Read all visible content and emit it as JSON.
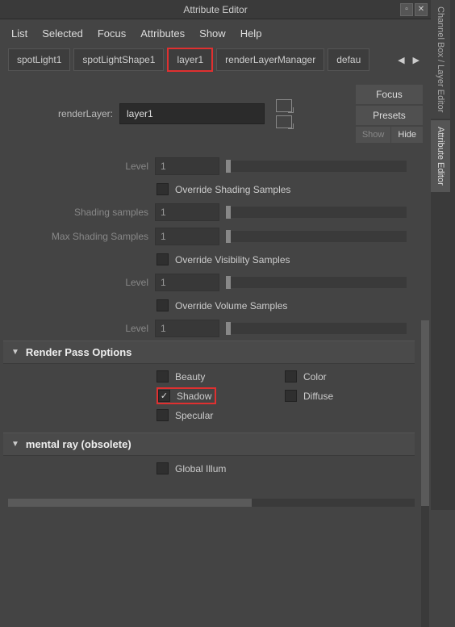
{
  "title": "Attribute Editor",
  "menu": {
    "list": "List",
    "selected": "Selected",
    "focus": "Focus",
    "attributes": "Attributes",
    "show": "Show",
    "help": "Help"
  },
  "tabs": [
    "spotLight1",
    "spotLightShape1",
    "layer1",
    "renderLayerManager",
    "defau"
  ],
  "layer": {
    "label": "renderLayer:",
    "value": "layer1"
  },
  "right_buttons": {
    "focus": "Focus",
    "presets": "Presets",
    "show": "Show",
    "hide": "Hide"
  },
  "attrs": {
    "level1": {
      "label": "Level",
      "value": "1"
    },
    "override_shading": "Override Shading Samples",
    "shading_samples": {
      "label": "Shading samples",
      "value": "1"
    },
    "max_shading": {
      "label": "Max Shading Samples",
      "value": "1"
    },
    "override_visibility": "Override Visibility Samples",
    "level2": {
      "label": "Level",
      "value": "1"
    },
    "override_volume": "Override Volume Samples",
    "level3": {
      "label": "Level",
      "value": "1"
    }
  },
  "sections": {
    "render_pass": "Render Pass Options",
    "mental_ray": "mental ray (obsolete)"
  },
  "passes": {
    "beauty": "Beauty",
    "color": "Color",
    "shadow": "Shadow",
    "diffuse": "Diffuse",
    "specular": "Specular",
    "global_illum": "Global Illum"
  },
  "side_tabs": {
    "channel": "Channel Box / Layer Editor",
    "attribute": "Attribute Editor"
  }
}
